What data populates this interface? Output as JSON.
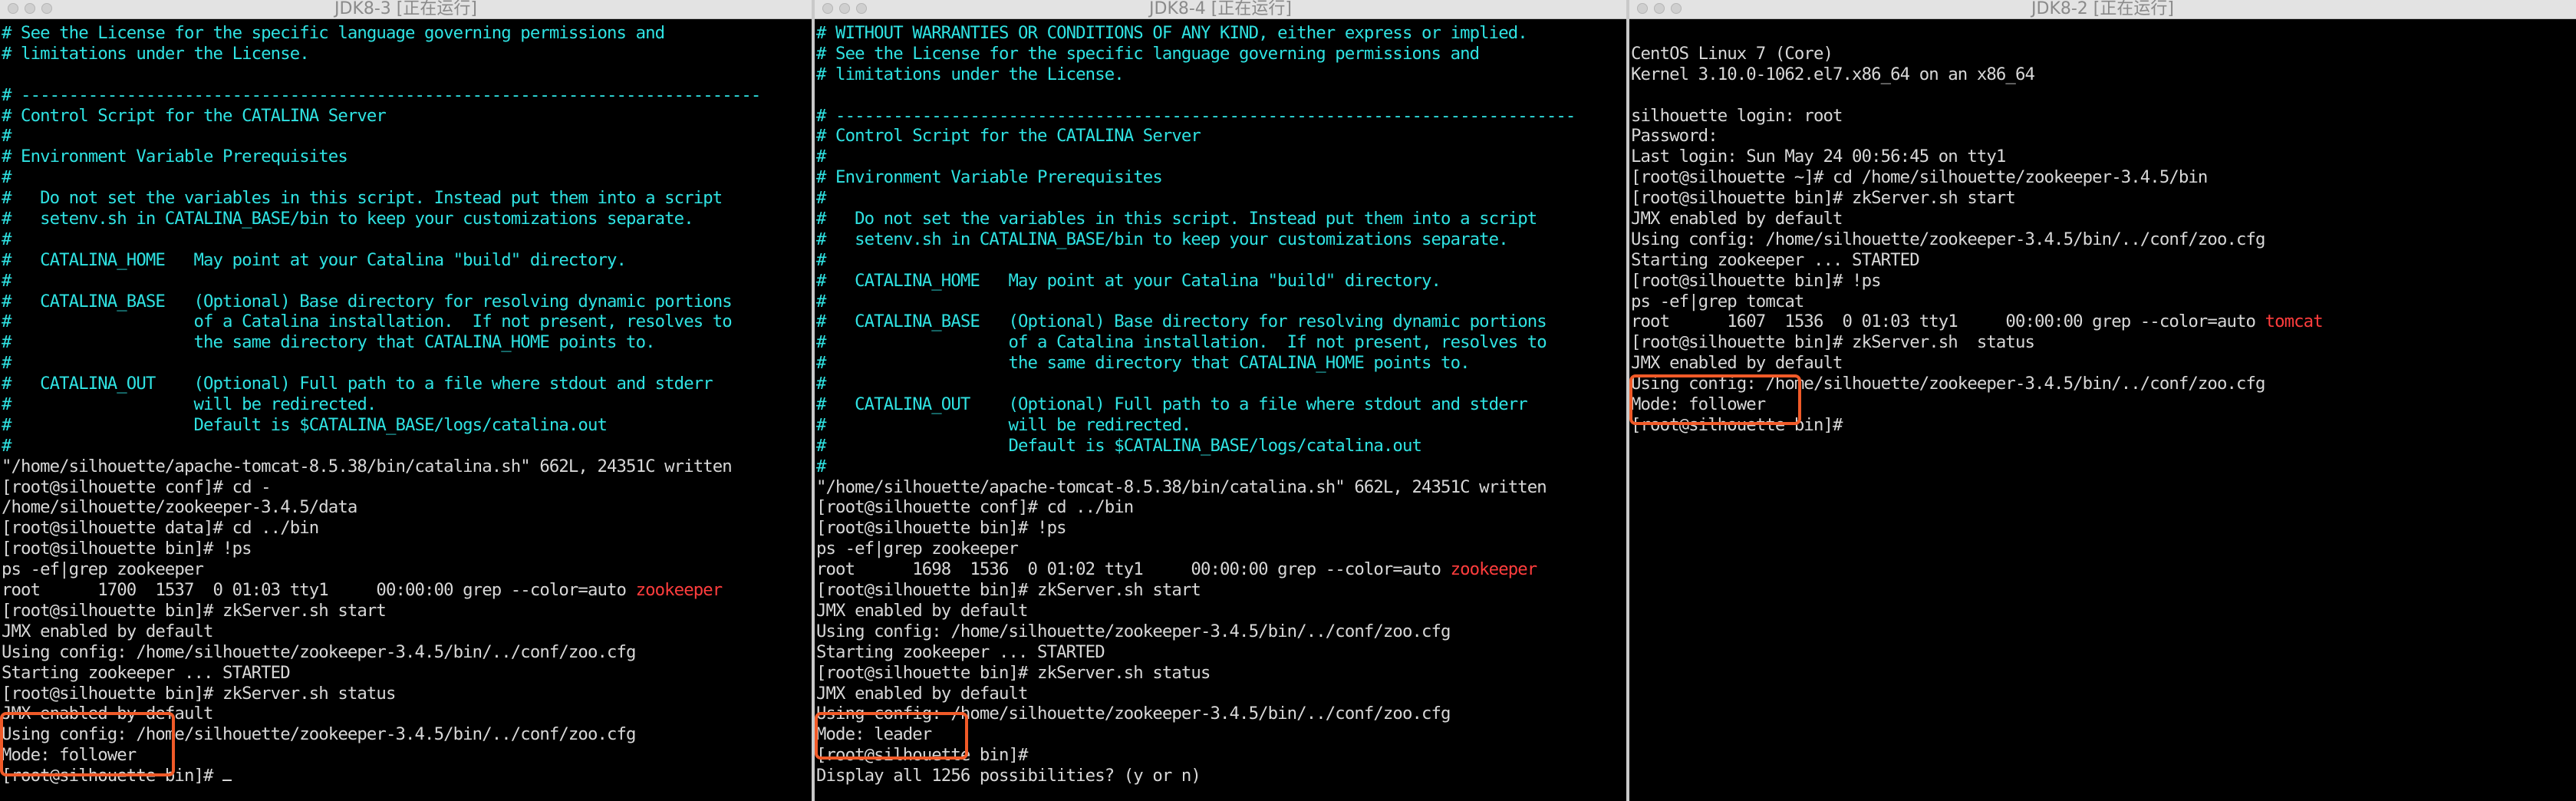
{
  "windows": [
    {
      "title": "JDK8-3 [正在运行]",
      "lines": [
        {
          "t": "# See the License for the specific language governing permissions and",
          "c": "cyan"
        },
        {
          "t": "# limitations under the License.",
          "c": "cyan"
        },
        {
          "t": "",
          "c": "cyan"
        },
        {
          "t": "# -----------------------------------------------------------------------------",
          "c": "cyan"
        },
        {
          "t": "# Control Script for the CATALINA Server",
          "c": "cyan"
        },
        {
          "t": "#",
          "c": "cyan"
        },
        {
          "t": "# Environment Variable Prerequisites",
          "c": "cyan"
        },
        {
          "t": "#",
          "c": "cyan"
        },
        {
          "t": "#   Do not set the variables in this script. Instead put them into a script",
          "c": "cyan"
        },
        {
          "t": "#   setenv.sh in CATALINA_BASE/bin to keep your customizations separate.",
          "c": "cyan"
        },
        {
          "t": "#",
          "c": "cyan"
        },
        {
          "t": "#   CATALINA_HOME   May point at your Catalina \"build\" directory.",
          "c": "cyan"
        },
        {
          "t": "#",
          "c": "cyan"
        },
        {
          "t": "#   CATALINA_BASE   (Optional) Base directory for resolving dynamic portions",
          "c": "cyan"
        },
        {
          "t": "#                   of a Catalina installation.  If not present, resolves to",
          "c": "cyan"
        },
        {
          "t": "#                   the same directory that CATALINA_HOME points to.",
          "c": "cyan"
        },
        {
          "t": "#",
          "c": "cyan"
        },
        {
          "t": "#   CATALINA_OUT    (Optional) Full path to a file where stdout and stderr",
          "c": "cyan"
        },
        {
          "t": "#                   will be redirected.",
          "c": "cyan"
        },
        {
          "t": "#                   Default is $CATALINA_BASE/logs/catalina.out",
          "c": "cyan"
        },
        {
          "t": "#",
          "c": "cyan"
        },
        {
          "t": "\"/home/silhouette/apache-tomcat-8.5.38/bin/catalina.sh\" 662L, 24351C written",
          "c": "white"
        },
        {
          "t": "[root@silhouette conf]# cd -",
          "c": "white"
        },
        {
          "t": "/home/silhouette/zookeeper-3.4.5/data",
          "c": "white"
        },
        {
          "t": "[root@silhouette data]# cd ../bin",
          "c": "white"
        },
        {
          "t": "[root@silhouette bin]# !ps",
          "c": "white"
        },
        {
          "t": "ps -ef|grep zookeeper",
          "c": "white"
        },
        {
          "t": "root      1700  1537  0 01:03 tty1     00:00:00 grep --color=auto ",
          "c": "white",
          "red": "zookeeper"
        },
        {
          "t": "[root@silhouette bin]# zkServer.sh start",
          "c": "white"
        },
        {
          "t": "JMX enabled by default",
          "c": "white"
        },
        {
          "t": "Using config: /home/silhouette/zookeeper-3.4.5/bin/../conf/zoo.cfg",
          "c": "white"
        },
        {
          "t": "Starting zookeeper ... STARTED",
          "c": "white"
        },
        {
          "t": "[root@silhouette bin]# zkServer.sh status",
          "c": "white"
        },
        {
          "t": "JMX enabled by default",
          "c": "white"
        },
        {
          "t": "Using config: /home/silhouette/zookeeper-3.4.5/bin/../conf/zoo.cfg",
          "c": "white"
        },
        {
          "t": "Mode: follower",
          "c": "white"
        },
        {
          "t": "[root@silhouette bin]# ",
          "c": "white",
          "cursor": true
        }
      ]
    },
    {
      "title": "JDK8-4 [正在运行]",
      "lines": [
        {
          "t": "# WITHOUT WARRANTIES OR CONDITIONS OF ANY KIND, either express or implied.",
          "c": "cyan"
        },
        {
          "t": "# See the License for the specific language governing permissions and",
          "c": "cyan"
        },
        {
          "t": "# limitations under the License.",
          "c": "cyan"
        },
        {
          "t": "",
          "c": "cyan"
        },
        {
          "t": "# -----------------------------------------------------------------------------",
          "c": "cyan"
        },
        {
          "t": "# Control Script for the CATALINA Server",
          "c": "cyan"
        },
        {
          "t": "#",
          "c": "cyan"
        },
        {
          "t": "# Environment Variable Prerequisites",
          "c": "cyan"
        },
        {
          "t": "#",
          "c": "cyan"
        },
        {
          "t": "#   Do not set the variables in this script. Instead put them into a script",
          "c": "cyan"
        },
        {
          "t": "#   setenv.sh in CATALINA_BASE/bin to keep your customizations separate.",
          "c": "cyan"
        },
        {
          "t": "#",
          "c": "cyan"
        },
        {
          "t": "#   CATALINA_HOME   May point at your Catalina \"build\" directory.",
          "c": "cyan"
        },
        {
          "t": "#",
          "c": "cyan"
        },
        {
          "t": "#   CATALINA_BASE   (Optional) Base directory for resolving dynamic portions",
          "c": "cyan"
        },
        {
          "t": "#                   of a Catalina installation.  If not present, resolves to",
          "c": "cyan"
        },
        {
          "t": "#                   the same directory that CATALINA_HOME points to.",
          "c": "cyan"
        },
        {
          "t": "#",
          "c": "cyan"
        },
        {
          "t": "#   CATALINA_OUT    (Optional) Full path to a file where stdout and stderr",
          "c": "cyan"
        },
        {
          "t": "#                   will be redirected.",
          "c": "cyan"
        },
        {
          "t": "#                   Default is $CATALINA_BASE/logs/catalina.out",
          "c": "cyan"
        },
        {
          "t": "#",
          "c": "cyan"
        },
        {
          "t": "\"/home/silhouette/apache-tomcat-8.5.38/bin/catalina.sh\" 662L, 24351C written",
          "c": "white"
        },
        {
          "t": "[root@silhouette conf]# cd ../bin",
          "c": "white"
        },
        {
          "t": "[root@silhouette bin]# !ps",
          "c": "white"
        },
        {
          "t": "ps -ef|grep zookeeper",
          "c": "white"
        },
        {
          "t": "root      1698  1536  0 01:02 tty1     00:00:00 grep --color=auto ",
          "c": "white",
          "red": "zookeeper"
        },
        {
          "t": "[root@silhouette bin]# zkServer.sh start",
          "c": "white"
        },
        {
          "t": "JMX enabled by default",
          "c": "white"
        },
        {
          "t": "Using config: /home/silhouette/zookeeper-3.4.5/bin/../conf/zoo.cfg",
          "c": "white"
        },
        {
          "t": "Starting zookeeper ... STARTED",
          "c": "white"
        },
        {
          "t": "[root@silhouette bin]# zkServer.sh status",
          "c": "white"
        },
        {
          "t": "JMX enabled by default",
          "c": "white"
        },
        {
          "t": "Using config: /home/silhouette/zookeeper-3.4.5/bin/../conf/zoo.cfg",
          "c": "white"
        },
        {
          "t": "Mode: leader",
          "c": "white"
        },
        {
          "t": "[root@silhouette bin]#",
          "c": "white"
        },
        {
          "t": "Display all 1256 possibilities? (y or n)",
          "c": "white"
        }
      ]
    },
    {
      "title": "JDK8-2 [正在运行]",
      "lines": [
        {
          "t": "",
          "c": "white"
        },
        {
          "t": "CentOS Linux 7 (Core)",
          "c": "white"
        },
        {
          "t": "Kernel 3.10.0-1062.el7.x86_64 on an x86_64",
          "c": "white"
        },
        {
          "t": "",
          "c": "white"
        },
        {
          "t": "silhouette login: root",
          "c": "white"
        },
        {
          "t": "Password:",
          "c": "white"
        },
        {
          "t": "Last login: Sun May 24 00:56:45 on tty1",
          "c": "white"
        },
        {
          "t": "[root@silhouette ~]# cd /home/silhouette/zookeeper-3.4.5/bin",
          "c": "white"
        },
        {
          "t": "[root@silhouette bin]# zkServer.sh start",
          "c": "white"
        },
        {
          "t": "JMX enabled by default",
          "c": "white"
        },
        {
          "t": "Using config: /home/silhouette/zookeeper-3.4.5/bin/../conf/zoo.cfg",
          "c": "white"
        },
        {
          "t": "Starting zookeeper ... STARTED",
          "c": "white"
        },
        {
          "t": "[root@silhouette bin]# !ps",
          "c": "white"
        },
        {
          "t": "ps -ef|grep tomcat",
          "c": "white"
        },
        {
          "t": "root      1607  1536  0 01:03 tty1     00:00:00 grep --color=auto ",
          "c": "white",
          "red": "tomcat"
        },
        {
          "t": "[root@silhouette bin]# zkServer.sh  status",
          "c": "white"
        },
        {
          "t": "JMX enabled by default",
          "c": "white"
        },
        {
          "t": "Using config: /home/silhouette/zookeeper-3.4.5/bin/../conf/zoo.cfg",
          "c": "white"
        },
        {
          "t": "Mode: follower",
          "c": "white"
        },
        {
          "t": "[root@silhouette bin]#",
          "c": "white"
        }
      ]
    }
  ]
}
